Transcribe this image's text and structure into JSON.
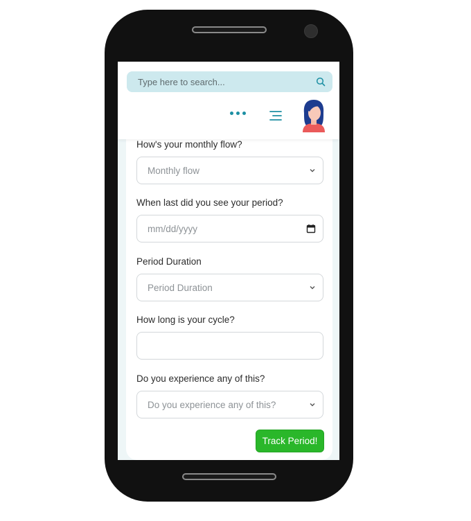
{
  "search": {
    "placeholder": "Type here to search..."
  },
  "header": {
    "more_icon": "more-dots-icon",
    "menu_icon": "hamburger-menu-icon",
    "avatar_icon": "user-avatar"
  },
  "form": {
    "flow": {
      "label": "How's your monthly flow?",
      "value": "Monthly flow"
    },
    "last_period": {
      "label": "When last did you see your period?",
      "value": "mm/dd/yyyy"
    },
    "duration": {
      "label": "Period Duration",
      "value": "Period Duration"
    },
    "cycle": {
      "label": "How long is your cycle?",
      "value": ""
    },
    "symptoms": {
      "label": "Do you experience any of this?",
      "value": "Do you experience any of this?"
    },
    "submit_label": "Track Period!"
  },
  "colors": {
    "accent": "#1c8fa3",
    "search_bg": "#cde9ee",
    "button": "#2ab72a"
  }
}
